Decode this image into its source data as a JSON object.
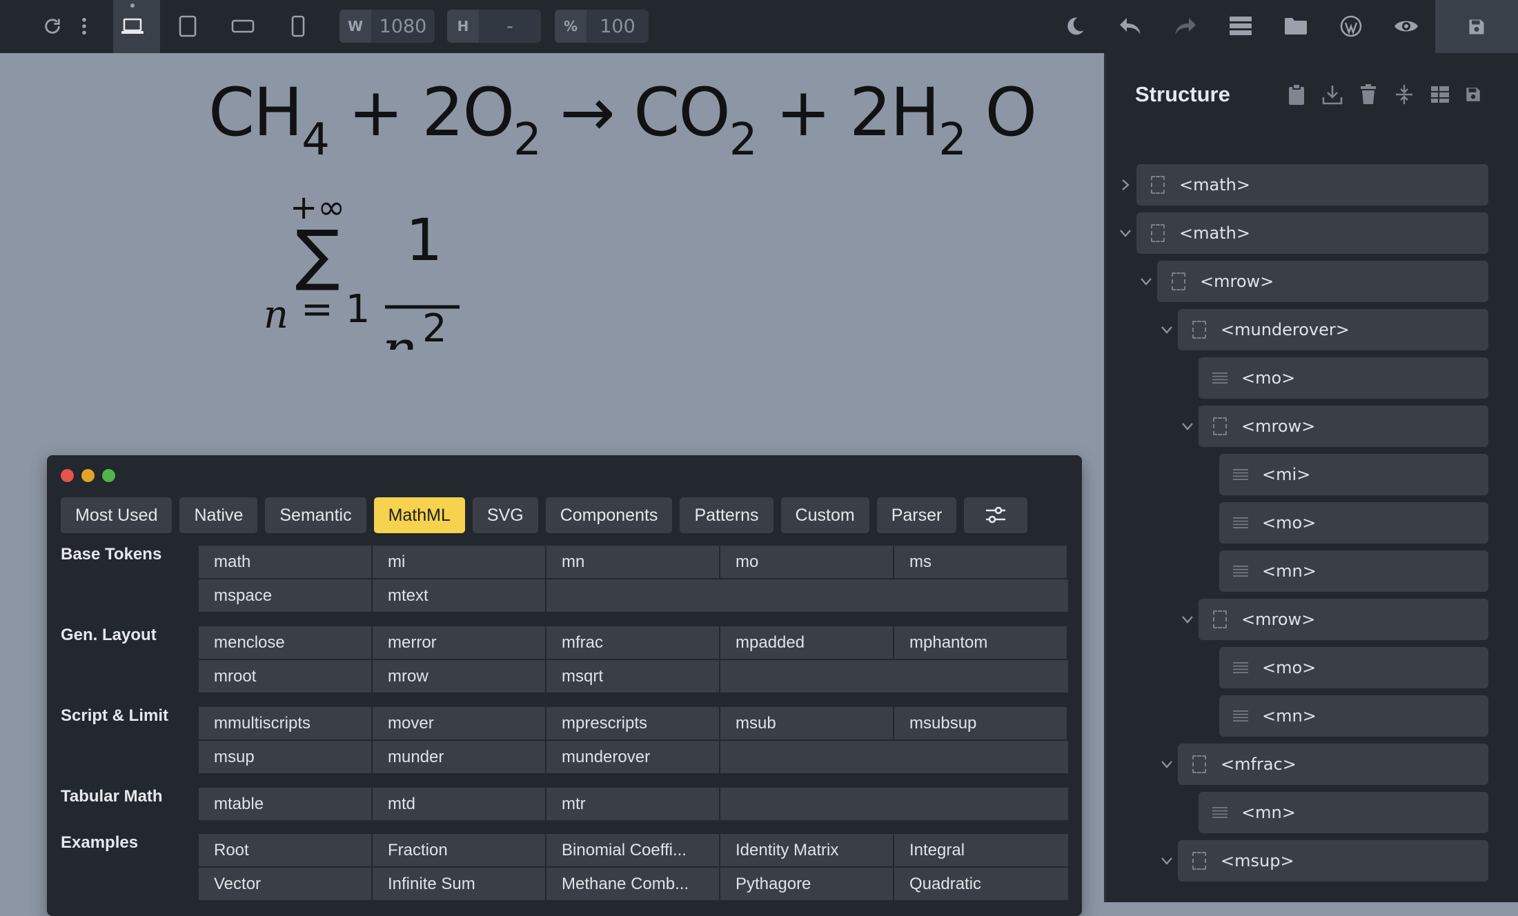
{
  "toolbar": {
    "width_label": "W",
    "width_value": "1080",
    "height_label": "H",
    "height_value": "-",
    "zoom_label": "%",
    "zoom_value": "100"
  },
  "canvas": {
    "equation1": {
      "parts": [
        "CH",
        "4",
        "+ 2O",
        "2",
        "→ CO",
        "2",
        "+ 2H",
        "2",
        "O"
      ]
    },
    "sum": {
      "upper": "+∞",
      "sigma": "∑",
      "lower_var": "n",
      "lower_eq": "= 1",
      "numerator": "1",
      "denominator_var": "n",
      "exponent": "2"
    }
  },
  "panel": {
    "title": "Structure",
    "tree": [
      {
        "label": "<math>",
        "icon": "box",
        "chevron": "right"
      },
      {
        "label": "<math>",
        "icon": "box",
        "chevron": "down"
      },
      {
        "label": "<mrow>",
        "icon": "box",
        "chevron": "down"
      },
      {
        "label": "<munderover>",
        "icon": "box",
        "chevron": "down"
      },
      {
        "label": "<mo>",
        "icon": "lines",
        "chevron": ""
      },
      {
        "label": "<mrow>",
        "icon": "box",
        "chevron": "down"
      },
      {
        "label": "<mi>",
        "icon": "lines",
        "chevron": ""
      },
      {
        "label": "<mo>",
        "icon": "lines",
        "chevron": ""
      },
      {
        "label": "<mn>",
        "icon": "lines",
        "chevron": ""
      },
      {
        "label": "<mrow>",
        "icon": "box",
        "chevron": "down"
      },
      {
        "label": "<mo>",
        "icon": "lines",
        "chevron": ""
      },
      {
        "label": "<mn>",
        "icon": "lines",
        "chevron": ""
      },
      {
        "label": "<mfrac>",
        "icon": "box",
        "chevron": "down"
      },
      {
        "label": "<mn>",
        "icon": "lines",
        "chevron": ""
      },
      {
        "label": "<msup>",
        "icon": "box",
        "chevron": "down"
      }
    ]
  },
  "window": {
    "tabs": [
      "Most Used",
      "Native",
      "Semantic",
      "MathML",
      "SVG",
      "Components",
      "Patterns",
      "Custom",
      "Parser"
    ],
    "active_tab": "MathML",
    "categories": [
      {
        "label": "Base Tokens",
        "items": [
          "math",
          "mi",
          "mn",
          "mo",
          "ms",
          "mspace",
          "mtext"
        ]
      },
      {
        "label": "Gen. Layout",
        "items": [
          "menclose",
          "merror",
          "mfrac",
          "mpadded",
          "mphantom",
          "mroot",
          "mrow",
          "msqrt"
        ]
      },
      {
        "label": "Script & Limit",
        "items": [
          "mmultiscripts",
          "mover",
          "mprescripts",
          "msub",
          "msubsup",
          "msup",
          "munder",
          "munderover"
        ]
      },
      {
        "label": "Tabular Math",
        "items": [
          "mtable",
          "mtd",
          "mtr"
        ]
      },
      {
        "label": "Examples",
        "items": [
          "Root",
          "Fraction",
          "Binomial Coeffi...",
          "Identity Matrix",
          "Integral",
          "Vector",
          "Infinite Sum",
          "Methane Comb...",
          "Pythagore",
          "Quadratic"
        ]
      }
    ]
  },
  "colors": {
    "accent": "#f6d24e",
    "close": "#e5534b",
    "minimize": "#e0a526",
    "maximize": "#4fb748"
  }
}
